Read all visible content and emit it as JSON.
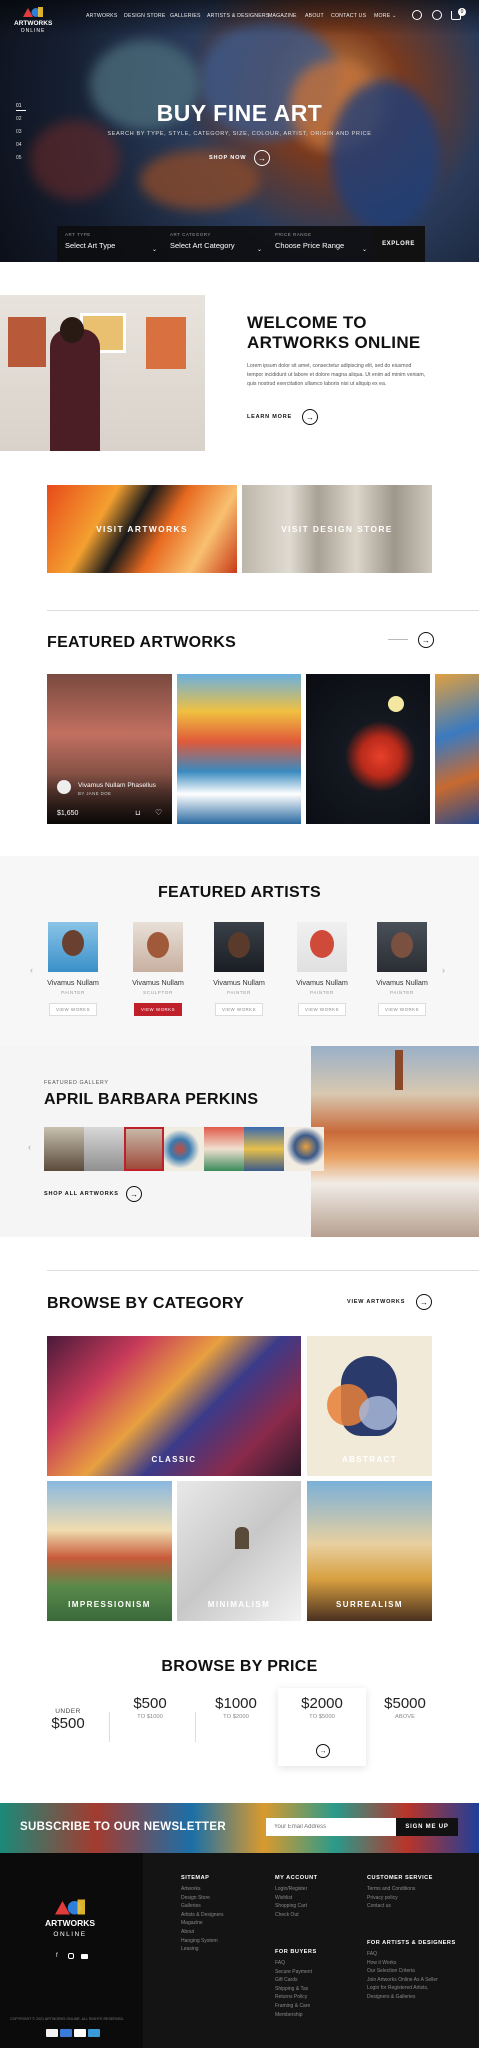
{
  "header": {
    "logo_text": "ARTWORKS",
    "logo_sub": "ONLINE",
    "nav": [
      "ARTWORKS",
      "DESIGN STORE",
      "GALLERIES",
      "ARTISTS & DESIGNERS",
      "MAGAZINE",
      "ABOUT",
      "CONTACT US",
      "MORE"
    ],
    "cart_count": "0"
  },
  "hero": {
    "slides": [
      "01",
      "02",
      "03",
      "04",
      "05"
    ],
    "title": "BUY FINE ART",
    "subtitle": "SEARCH BY TYPE, STYLE, CATEGORY, SIZE, COLOUR, ARTIST, ORIGIN AND PRICE",
    "cta": "SHOP NOW",
    "filters": [
      {
        "label": "ART TYPE",
        "value": "Select Art Type"
      },
      {
        "label": "ART CATEGORY",
        "value": "Select Art Category"
      },
      {
        "label": "PRICE RANGE",
        "value": "Choose Price Range"
      }
    ],
    "explore": "EXPLORE"
  },
  "welcome": {
    "title1": "WELCOME TO",
    "title2": "ARTWORKS ONLINE",
    "text": [
      "Lorem ipsum dolor sit amet, consectetur adipiscing elit, sed do eiusmod",
      "tempor incididunt ut labore et dolore magna aliqua. Ut enim ad minim veniam,",
      "quis nostrud exercitation ullamco laboris nisi ut aliquip ex ea."
    ],
    "cta": "LEARN MORE"
  },
  "banners": [
    "VISIT ARTWORKS",
    "VISIT DESIGN STORE"
  ],
  "featured_artworks": {
    "title": "FEATURED ARTWORKS",
    "card": {
      "name": "Vivamus Nullam Phasellus",
      "by": "BY JANE DOE",
      "price": "$1,650"
    }
  },
  "featured_artists": {
    "title": "FEATURED ARTISTS",
    "items": [
      {
        "name": "Vivamus Nullam",
        "role": "PAINTER",
        "btn": "VIEW WORKS"
      },
      {
        "name": "Vivamus Nullam",
        "role": "SCULPTOR",
        "btn": "VIEW WORKS"
      },
      {
        "name": "Vivamus Nullam",
        "role": "PAINTER",
        "btn": "VIEW WORKS"
      },
      {
        "name": "Vivamus Nullam",
        "role": "PAINTER",
        "btn": "VIEW WORKS"
      },
      {
        "name": "Vivamus Nullam",
        "role": "PAINTER",
        "btn": "VIEW WORKS"
      }
    ]
  },
  "gallery": {
    "kicker": "FEATURED GALLERY",
    "name": "APRIL BARBARA PERKINS",
    "cta": "SHOP ALL ARTWORKS"
  },
  "categories": {
    "title": "BROWSE BY CATEGORY",
    "view": "VIEW ARTWORKS",
    "items": [
      "CLASSIC",
      "ABSTRACT",
      "IMPRESSIONISM",
      "MINIMALISM",
      "SURREALISM"
    ]
  },
  "prices": {
    "title": "BROWSE BY PRICE",
    "items": [
      {
        "under": "UNDER",
        "amount": "$500",
        "to": ""
      },
      {
        "under": "",
        "amount": "$500",
        "to": "TO $1000"
      },
      {
        "under": "",
        "amount": "$1000",
        "to": "TO $2000"
      },
      {
        "under": "",
        "amount": "$2000",
        "to": "TO $5000"
      },
      {
        "under": "",
        "amount": "$5000",
        "to": "ABOVE"
      }
    ]
  },
  "newsletter": {
    "title": "SUBSCRIBE TO OUR NEWSLETTER",
    "placeholder": "Your Email Address",
    "btn": "SIGN ME UP"
  },
  "footer": {
    "copyright": "COPYRIGHT © 2021 ARTWORKS ONLINE. ALL RIGHTS RESERVED.",
    "sitemap": {
      "title": "SITEMAP",
      "links": [
        "Artworks",
        "Design Store",
        "Galleries",
        "Artists & Designers",
        "Magazine",
        "About",
        "Hanging System",
        "Leasing"
      ]
    },
    "account": {
      "title": "MY ACCOUNT",
      "links": [
        "Login/Register",
        "Wishlist",
        "Shopping Cart",
        "Check Out"
      ]
    },
    "service": {
      "title": "CUSTOMER SERVICE",
      "links": [
        "Terms and Conditions",
        "Privacy policy",
        "Contact us"
      ]
    },
    "buyers": {
      "title": "FOR BUYERS",
      "links": [
        "FAQ",
        "Secure Payment",
        "Gift Cards",
        "Shipping & Tax",
        "Returns Policy",
        "Framing & Care",
        "Membership"
      ]
    },
    "artists": {
      "title": "FOR ARTISTS & DESIGNERS",
      "links": [
        "FAQ",
        "How it Works",
        "Our Selection Criteria",
        "Join Artworks Online As A Seller",
        "Login for Registered Artists,",
        "Designers & Galleries"
      ]
    }
  }
}
